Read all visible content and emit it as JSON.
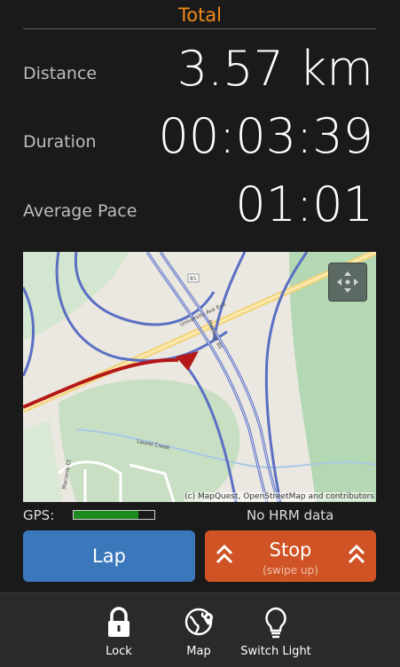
{
  "header": {
    "title": "Total"
  },
  "stats": {
    "distance_label": "Distance",
    "distance_value": "3.57 km",
    "duration_label": "Duration",
    "duration_value": "00:03:39",
    "pace_label": "Average Pace",
    "pace_value": "01:01"
  },
  "map": {
    "attribution": "(c) MapQuest, OpenStreetMap and contributors",
    "road_labels": [
      "85",
      "University Ave Exit",
      "Freeway 85",
      "Laurel Creek",
      "Macomb Ct"
    ],
    "route_color": "#b41818",
    "controls_icon": "move-arrows-icon"
  },
  "status": {
    "gps_label": "GPS:",
    "gps_signal": 0.8,
    "hrm_text": "No HRM data"
  },
  "buttons": {
    "lap_label": "Lap",
    "stop_label": "Stop",
    "stop_hint": "(swipe up)"
  },
  "actions": [
    {
      "label": "Lock",
      "icon": "lock-icon"
    },
    {
      "label": "Map",
      "icon": "globe-pin-icon"
    },
    {
      "label": "Switch Light",
      "icon": "lightbulb-icon"
    }
  ],
  "colors": {
    "accent": "#f28a1e",
    "lap": "#3a78bb",
    "stop": "#cf5324",
    "gps_fill": "#1d8a1d"
  }
}
